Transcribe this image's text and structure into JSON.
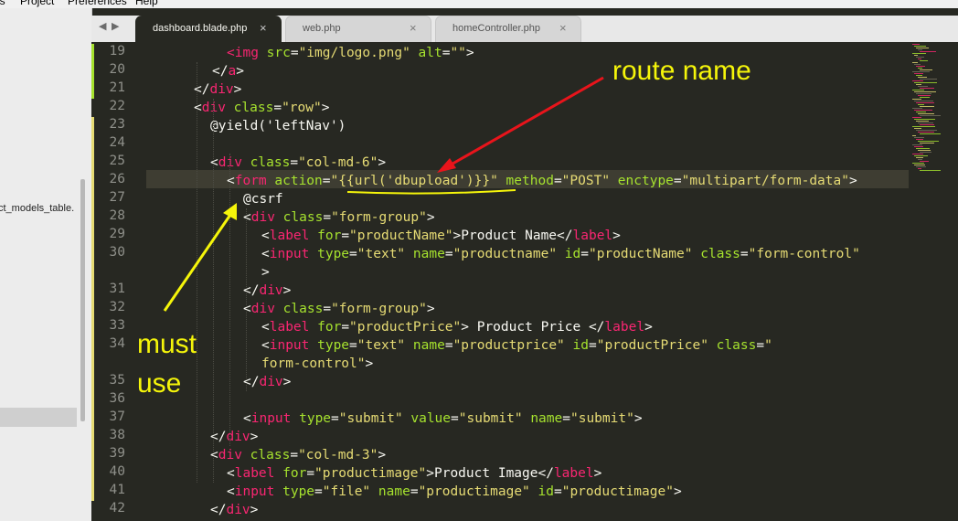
{
  "menubar": {
    "items": [
      "ls",
      "Project",
      "Preferences",
      "Help"
    ]
  },
  "sidebar": {
    "file_fragment": "ct_models_table."
  },
  "tab_nav": {
    "left": "◀",
    "right": "▶"
  },
  "tabs": [
    {
      "label": "dashboard.blade.php",
      "close": "×",
      "active": true
    },
    {
      "label": "web.php",
      "close": "×",
      "active": false
    },
    {
      "label": "homeController.php",
      "close": "×",
      "active": false
    }
  ],
  "editor": {
    "line_numbers": [
      "19",
      "20",
      "21",
      "22",
      "23",
      "24",
      "25",
      "26",
      "27",
      "28",
      "29",
      "30",
      "31",
      "32",
      "33",
      "34",
      "35",
      "36",
      "37",
      "38",
      "39",
      "40",
      "41",
      "42"
    ],
    "current_line": "26",
    "lines": [
      [
        [
          "t",
          "<img"
        ],
        [
          "a",
          " src"
        ],
        [
          "p",
          "="
        ],
        [
          "s",
          "\"img/logo.png\""
        ],
        [
          "a",
          " alt"
        ],
        [
          "p",
          "="
        ],
        [
          "s",
          "\"\""
        ],
        [
          "p",
          ">"
        ]
      ],
      [
        [
          "p",
          "</"
        ],
        [
          "t",
          "a"
        ],
        [
          "p",
          ">"
        ]
      ],
      [
        [
          "p",
          "</"
        ],
        [
          "t",
          "div"
        ],
        [
          "p",
          ">"
        ]
      ],
      [
        [
          "p",
          "<"
        ],
        [
          "t",
          "div"
        ],
        [
          "a",
          " class"
        ],
        [
          "p",
          "="
        ],
        [
          "s",
          "\"row\""
        ],
        [
          "p",
          ">"
        ]
      ],
      [
        [
          "p",
          "@yield('leftNav')"
        ]
      ],
      [],
      [
        [
          "p",
          "<"
        ],
        [
          "t",
          "div"
        ],
        [
          "a",
          " class"
        ],
        [
          "p",
          "="
        ],
        [
          "s",
          "\"col-md-6\""
        ],
        [
          "p",
          ">"
        ]
      ],
      [
        [
          "p",
          "<"
        ],
        [
          "t",
          "form"
        ],
        [
          "a",
          " action"
        ],
        [
          "p",
          "="
        ],
        [
          "s",
          "\"{{url('dbupload')}}\""
        ],
        [
          "a",
          " method"
        ],
        [
          "p",
          "="
        ],
        [
          "s",
          "\"POST\""
        ],
        [
          "a",
          " enctype"
        ],
        [
          "p",
          "="
        ],
        [
          "s",
          "\"multipart/form-data\""
        ],
        [
          "p",
          ">"
        ]
      ],
      [
        [
          "p",
          "@csrf"
        ]
      ],
      [
        [
          "p",
          "<"
        ],
        [
          "t",
          "div"
        ],
        [
          "a",
          " class"
        ],
        [
          "p",
          "="
        ],
        [
          "s",
          "\"form-group\""
        ],
        [
          "p",
          ">"
        ]
      ],
      [
        [
          "p",
          "<"
        ],
        [
          "t",
          "label"
        ],
        [
          "a",
          " for"
        ],
        [
          "p",
          "="
        ],
        [
          "s",
          "\"productName\""
        ],
        [
          "p",
          ">Product Name</"
        ],
        [
          "t",
          "label"
        ],
        [
          "p",
          ">"
        ]
      ],
      [
        [
          "p",
          "<"
        ],
        [
          "t",
          "input"
        ],
        [
          "a",
          " type"
        ],
        [
          "p",
          "="
        ],
        [
          "s",
          "\"text\""
        ],
        [
          "a",
          " name"
        ],
        [
          "p",
          "="
        ],
        [
          "s",
          "\"productname\""
        ],
        [
          "a",
          " id"
        ],
        [
          "p",
          "="
        ],
        [
          "s",
          "\"productName\""
        ],
        [
          "a",
          " class"
        ],
        [
          "p",
          "="
        ],
        [
          "s",
          "\"form-control\""
        ]
      ],
      [
        [
          "p",
          ">"
        ]
      ],
      [
        [
          "p",
          "</"
        ],
        [
          "t",
          "div"
        ],
        [
          "p",
          ">"
        ]
      ],
      [
        [
          "p",
          "<"
        ],
        [
          "t",
          "div"
        ],
        [
          "a",
          " class"
        ],
        [
          "p",
          "="
        ],
        [
          "s",
          "\"form-group\""
        ],
        [
          "p",
          ">"
        ]
      ],
      [
        [
          "p",
          "<"
        ],
        [
          "t",
          "label"
        ],
        [
          "a",
          " for"
        ],
        [
          "p",
          "="
        ],
        [
          "s",
          "\"productPrice\""
        ],
        [
          "p",
          "> Product Price </"
        ],
        [
          "t",
          "label"
        ],
        [
          "p",
          ">"
        ]
      ],
      [
        [
          "p",
          "<"
        ],
        [
          "t",
          "input"
        ],
        [
          "a",
          " type"
        ],
        [
          "p",
          "="
        ],
        [
          "s",
          "\"text\""
        ],
        [
          "a",
          " name"
        ],
        [
          "p",
          "="
        ],
        [
          "s",
          "\"productprice\""
        ],
        [
          "a",
          " id"
        ],
        [
          "p",
          "="
        ],
        [
          "s",
          "\"productPrice\""
        ],
        [
          "a",
          " class"
        ],
        [
          "p",
          "="
        ],
        [
          "s",
          "\""
        ]
      ],
      [
        [
          "s",
          "form-control\""
        ],
        [
          "p",
          ">"
        ]
      ],
      [
        [
          "p",
          "</"
        ],
        [
          "t",
          "div"
        ],
        [
          "p",
          ">"
        ]
      ],
      [],
      [
        [
          "p",
          "<"
        ],
        [
          "t",
          "input"
        ],
        [
          "a",
          " type"
        ],
        [
          "p",
          "="
        ],
        [
          "s",
          "\"submit\""
        ],
        [
          "a",
          " value"
        ],
        [
          "p",
          "="
        ],
        [
          "s",
          "\"submit\""
        ],
        [
          "a",
          " name"
        ],
        [
          "p",
          "="
        ],
        [
          "s",
          "\"submit\""
        ],
        [
          "p",
          ">"
        ]
      ],
      [
        [
          "p",
          "</"
        ],
        [
          "t",
          "div"
        ],
        [
          "p",
          ">"
        ]
      ],
      [
        [
          "p",
          "<"
        ],
        [
          "t",
          "div"
        ],
        [
          "a",
          " class"
        ],
        [
          "p",
          "="
        ],
        [
          "s",
          "\"col-md-3\""
        ],
        [
          "p",
          ">"
        ]
      ],
      [
        [
          "p",
          "<"
        ],
        [
          "t",
          "label"
        ],
        [
          "a",
          " for"
        ],
        [
          "p",
          "="
        ],
        [
          "s",
          "\"productimage\""
        ],
        [
          "p",
          ">Product Image</"
        ],
        [
          "t",
          "label"
        ],
        [
          "p",
          ">"
        ]
      ],
      [
        [
          "p",
          "<"
        ],
        [
          "t",
          "input"
        ],
        [
          "a",
          " type"
        ],
        [
          "p",
          "="
        ],
        [
          "s",
          "\"file\""
        ],
        [
          "a",
          " name"
        ],
        [
          "p",
          "="
        ],
        [
          "s",
          "\"productimage\""
        ],
        [
          "a",
          " id"
        ],
        [
          "p",
          "="
        ],
        [
          "s",
          "\"productimage\""
        ],
        [
          "p",
          ">"
        ]
      ],
      [
        [
          "p",
          "</"
        ],
        [
          "t",
          "div"
        ],
        [
          "p",
          ">"
        ]
      ]
    ]
  },
  "annotations": {
    "route_label": "route name",
    "must_label": "must",
    "use_label": "use",
    "color": "#f5f50a",
    "arrow_color": "#e8141b"
  },
  "theme": {
    "background": "#272822",
    "tag": "#f92672",
    "attribute": "#a6e22e",
    "string": "#e6db74",
    "text": "#f8f8f2",
    "line_number": "#8f908a"
  }
}
